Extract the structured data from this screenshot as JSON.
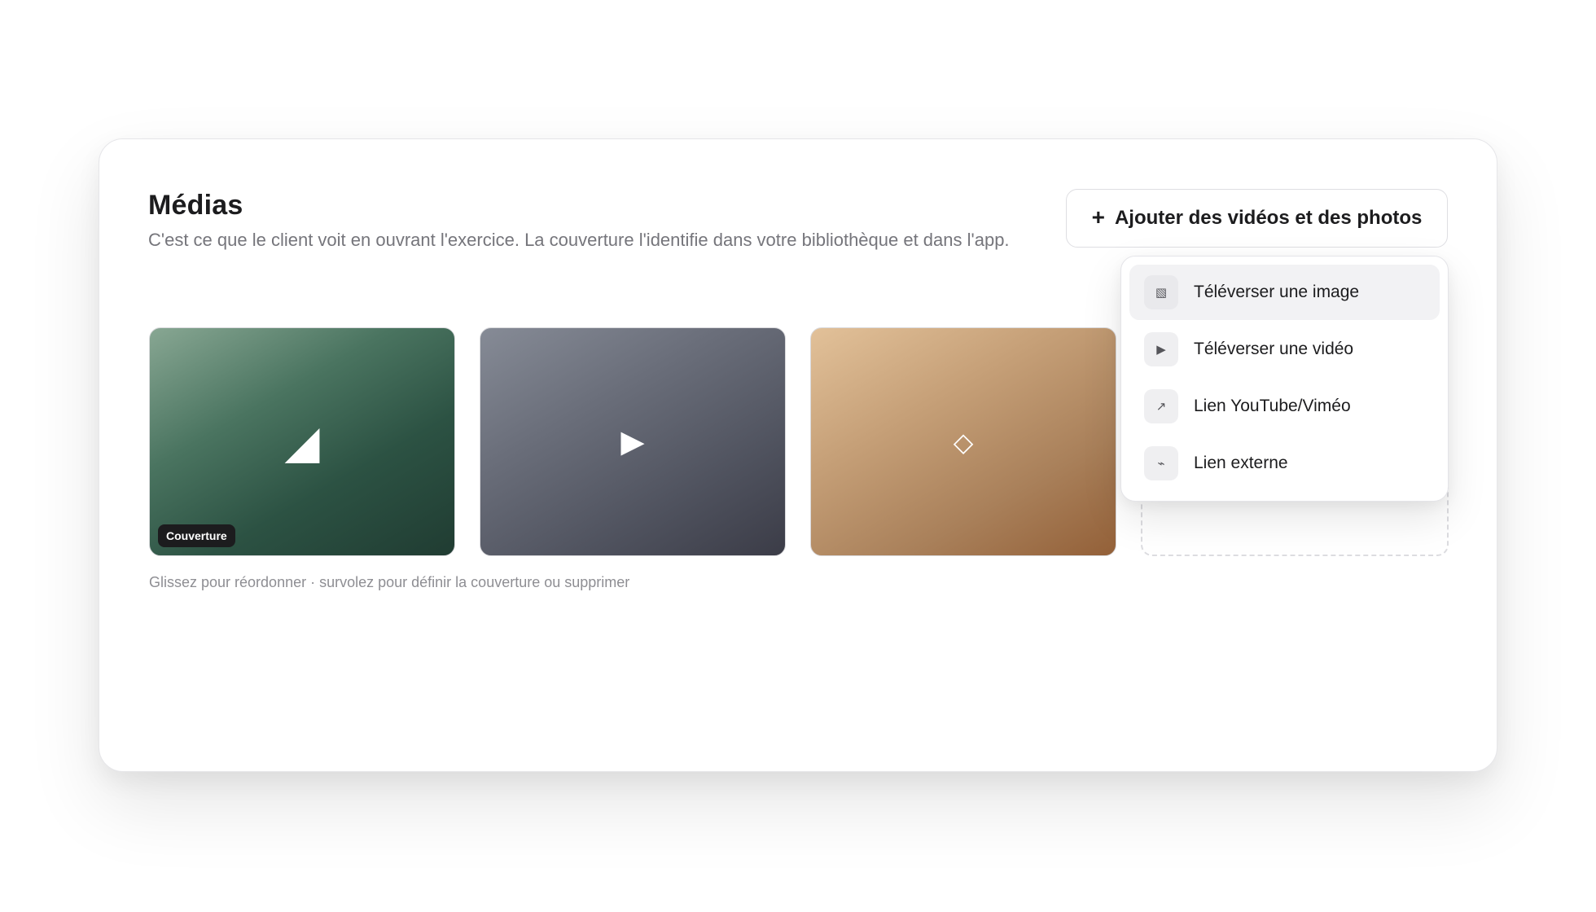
{
  "section": {
    "title": "Médias",
    "subtitle": "C'est ce que le client voit en ouvrant l'exercice. La couverture l'identifie dans votre bibliothèque et dans l'app."
  },
  "add_button": {
    "icon": "+",
    "label": "Ajouter des vidéos et des photos"
  },
  "media": [
    {
      "icon": "◢",
      "icon_name": "image-icon",
      "badge": "Couverture"
    },
    {
      "icon": "▶",
      "icon_name": "play-icon"
    },
    {
      "icon": "◇",
      "icon_name": "diamond-icon"
    }
  ],
  "hint": "Glissez pour réordonner · survolez pour définir la couverture ou supprimer",
  "menu": {
    "items": [
      {
        "icon": "▧",
        "icon_name": "image-icon",
        "label": "Téléverser une image"
      },
      {
        "icon": "▶",
        "icon_name": "play-icon",
        "label": "Téléverser une vidéo"
      },
      {
        "icon": "↗",
        "icon_name": "arrow-up-right-icon",
        "label": "Lien YouTube/Viméo"
      },
      {
        "icon": "⌁",
        "icon_name": "link-icon",
        "label": "Lien externe"
      }
    ]
  }
}
